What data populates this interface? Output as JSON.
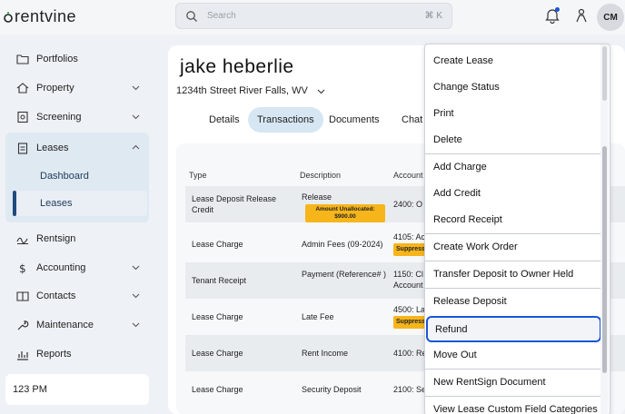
{
  "brand": {
    "logo_text": "rentvine"
  },
  "search": {
    "placeholder": "Search",
    "shortcut": "⌘ K"
  },
  "user": {
    "initials": "CM"
  },
  "sidebar": {
    "items": [
      {
        "label": "Portfolios",
        "icon": "folder-icon"
      },
      {
        "label": "Property",
        "icon": "house-icon"
      },
      {
        "label": "Screening",
        "icon": "screening-icon"
      },
      {
        "label": "Leases",
        "icon": "clipboard-icon"
      },
      {
        "label": "Rentsign",
        "icon": "signature-icon"
      },
      {
        "label": "Accounting",
        "icon": "dollar-icon"
      },
      {
        "label": "Contacts",
        "icon": "book-icon"
      },
      {
        "label": "Maintenance",
        "icon": "wrench-icon"
      },
      {
        "label": "Reports",
        "icon": "chart-icon"
      }
    ],
    "leases_sub": {
      "dashboard": "Dashboard",
      "leases": "Leases"
    },
    "footer": "123 PM"
  },
  "lease": {
    "tenant": "jake heberlie",
    "address": "1234th Street River Falls, WV"
  },
  "tabs": [
    "Details",
    "Transactions",
    "Documents",
    "Chat"
  ],
  "table": {
    "headers": {
      "type": "Type",
      "description": "Description",
      "account": "Account"
    },
    "rows": [
      {
        "type": "Lease Deposit Release Credit",
        "description": "Release",
        "badge": "Amount Unallocated: $900.00",
        "account": "2400: O"
      },
      {
        "type": "Lease Charge",
        "description": "Admin Fees (09-2024)",
        "account": "4105: Ac",
        "suppress": "Suppress"
      },
      {
        "type": "Tenant Receipt",
        "description": "Payment (Reference# )",
        "account": "1150: Cl",
        "account2": "Account"
      },
      {
        "type": "Lease Charge",
        "description": "Late Fee",
        "account": "4500: La",
        "suppress": "Suppress"
      },
      {
        "type": "Lease Charge",
        "description": "Rent Income",
        "account": "4100: Re"
      },
      {
        "type": "Lease Charge",
        "description": "Security Deposit",
        "account": "2100: Se"
      }
    ]
  },
  "menu": {
    "items": [
      "Create Lease",
      "Change Status",
      "Print",
      "Delete",
      "Add Charge",
      "Add Credit",
      "Record Receipt",
      "Create Work Order",
      "Transfer Deposit to Owner Held",
      "Release Deposit",
      "Refund",
      "Move Out",
      "New RentSign Document",
      "View Lease Custom Field Categories"
    ],
    "highlighted": "Refund"
  },
  "colors": {
    "accent": "#1a55d6",
    "badge": "#f6b51b",
    "active_nav": "#dfe9f2"
  }
}
